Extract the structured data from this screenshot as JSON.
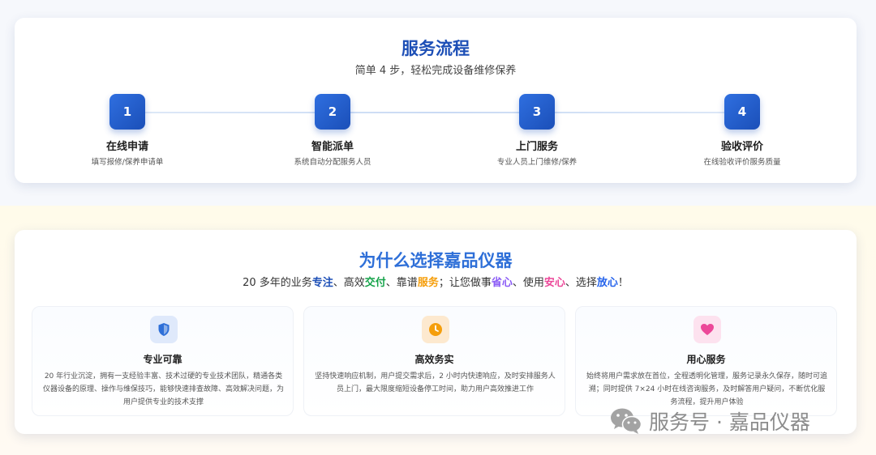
{
  "process": {
    "title": "服务流程",
    "subtitle": "简单 4 步，轻松完成设备维修保养",
    "steps": [
      {
        "number": "1",
        "title": "在线申请",
        "desc": "填写报修/保养申请单"
      },
      {
        "number": "2",
        "title": "智能派单",
        "desc": "系统自动分配服务人员"
      },
      {
        "number": "3",
        "title": "上门服务",
        "desc": "专业人员上门维修/保养"
      },
      {
        "number": "4",
        "title": "验收评价",
        "desc": "在线验收评价服务质量"
      }
    ]
  },
  "why": {
    "title": "为什么选择嘉品仪器",
    "tagline": {
      "t1": "20 多年的业务",
      "h1": "专注",
      "t2": "、高效",
      "h2": "交付",
      "t3": "、靠谱",
      "h3": "服务",
      "t4": "；让您做事",
      "h4": "省心",
      "t5": "、使用",
      "h5": "安心",
      "t6": "、选择",
      "h6": "放心",
      "t7": "！"
    },
    "features": [
      {
        "icon": "shield-icon",
        "title": "专业可靠",
        "desc": "20 年行业沉淀，拥有一支经验丰富、技术过硬的专业技术团队，精通各类仪器设备的原理、操作与维保技巧，能够快速排查故障、高效解决问题，为用户提供专业的技术支撑"
      },
      {
        "icon": "clock-icon",
        "title": "高效务实",
        "desc": "坚持快速响应机制，用户提交需求后，2 小时内快速响应，及时安排服务人员上门，最大限度缩短设备停工时间，助力用户高效推进工作"
      },
      {
        "icon": "heart-icon",
        "title": "用心服务",
        "desc": "始终将用户需求放在首位，全程透明化管理，服务记录永久保存，随时可追溯；同时提供 7×24 小时在线咨询服务，及时解答用户疑问，不断优化服务流程，提升用户体验"
      }
    ]
  },
  "watermark": {
    "text": "服务号 · 嘉品仪器"
  },
  "colors": {
    "title_blue": "#1d4fb6",
    "why_title_blue": "#2e6fd8",
    "step_badge": "#1e56c3",
    "hl_blue": "#1d4fb6",
    "hl_green": "#16a34a",
    "hl_orange": "#f59e0b",
    "hl_purple": "#8b5cf6",
    "hl_pink": "#ec4899",
    "hl_blue2": "#2563eb"
  }
}
